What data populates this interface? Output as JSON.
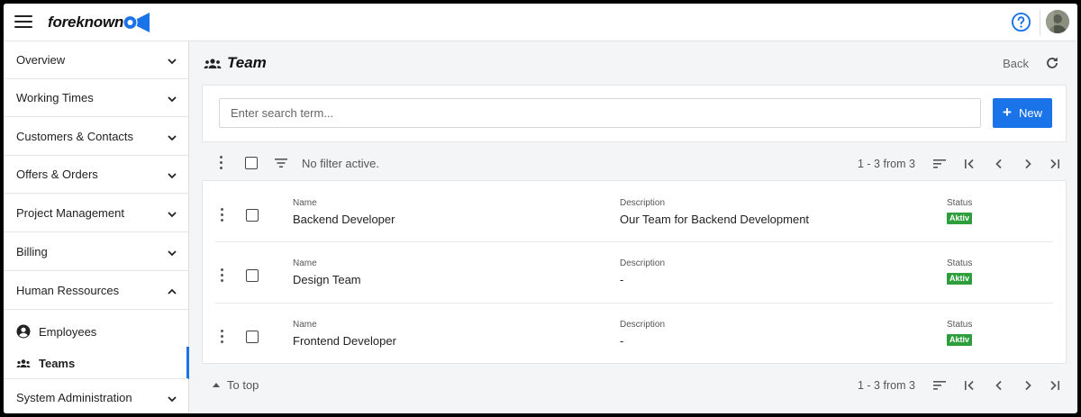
{
  "app": {
    "logo_text": "foreknown",
    "accent_color": "#1a73e8",
    "status_color": "#2e9d3b"
  },
  "sidebar": {
    "items": [
      {
        "label": "Overview",
        "expanded": false
      },
      {
        "label": "Working Times",
        "expanded": false
      },
      {
        "label": "Customers & Contacts",
        "expanded": false
      },
      {
        "label": "Offers & Orders",
        "expanded": false
      },
      {
        "label": "Project Management",
        "expanded": false
      },
      {
        "label": "Billing",
        "expanded": false
      },
      {
        "label": "Human Ressources",
        "expanded": true
      },
      {
        "label": "System Administration",
        "expanded": false
      }
    ],
    "subitems": [
      {
        "label": "Employees",
        "icon": "account-circle-icon",
        "active": false
      },
      {
        "label": "Teams",
        "icon": "groups-icon",
        "active": true
      }
    ]
  },
  "page": {
    "title": "Team",
    "back_label": "Back"
  },
  "search": {
    "placeholder": "Enter search term...",
    "value": "",
    "new_label": "New"
  },
  "toolbar": {
    "filter_text": "No filter active.",
    "pagination": "1 - 3 from 3"
  },
  "list": {
    "labels": {
      "name": "Name",
      "description": "Description",
      "status": "Status"
    },
    "rows": [
      {
        "name": "Backend Developer",
        "description": "Our Team for Backend Development",
        "status": "Aktiv"
      },
      {
        "name": "Design Team",
        "description": "-",
        "status": "Aktiv"
      },
      {
        "name": "Frontend Developer",
        "description": "-",
        "status": "Aktiv"
      }
    ]
  },
  "footer": {
    "to_top_label": "To top",
    "pagination": "1 - 3 from 3"
  }
}
